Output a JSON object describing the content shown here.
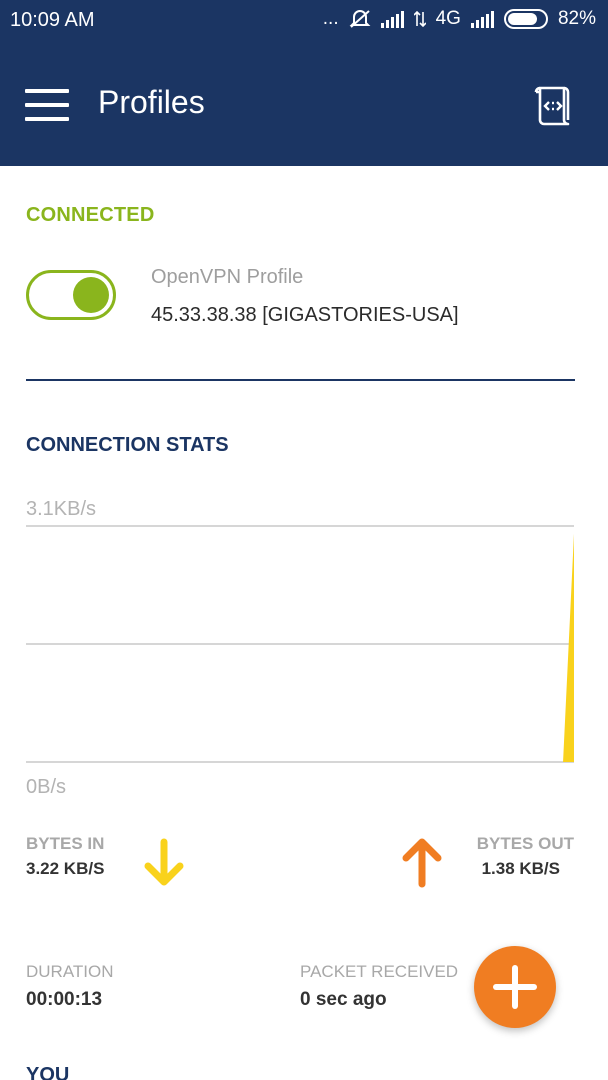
{
  "status_bar": {
    "time": "10:09  AM",
    "dots": "...",
    "network": "4G",
    "battery_percent": "82%",
    "battery_level": 0.82
  },
  "app_bar": {
    "title": "Profiles",
    "menu_icon": "hamburger-menu-icon",
    "import_icon": "import-profile-icon"
  },
  "connection": {
    "status": "CONNECTED",
    "toggle_on": true,
    "profile_name": "OpenVPN Profile",
    "server": "45.33.38.38 [GIGASTORIES-USA]"
  },
  "stats": {
    "title": "CONNECTION STATS",
    "bytes_in_label": "BYTES IN",
    "bytes_in_value": "3.22 KB/S",
    "bytes_out_label": "BYTES OUT",
    "bytes_out_value": "1.38 KB/S",
    "duration_label": "DURATION",
    "duration_value": "00:00:13",
    "packet_label": "PACKET RECEIVED",
    "packet_value": "0 sec ago"
  },
  "chart_data": {
    "type": "area",
    "y_max_label": "3.1KB/s",
    "y_min_label": "0B/s",
    "ylim": [
      0,
      3.1
    ],
    "grid": true,
    "series": [
      {
        "color": "#f9d21c",
        "values": [
          0,
          0,
          0,
          0,
          0,
          0,
          0,
          0,
          0,
          0,
          0,
          0,
          0,
          0,
          0,
          0,
          0,
          0,
          0,
          0,
          0,
          0,
          0,
          0,
          0,
          0,
          0,
          0,
          0,
          0,
          0,
          0,
          0,
          0,
          0,
          0,
          0,
          0,
          0,
          0,
          0,
          0,
          0,
          0,
          0,
          0,
          0,
          0,
          0,
          0,
          3.0
        ]
      }
    ]
  },
  "colors": {
    "primary": "#1b3563",
    "connected": "#8ab51d",
    "bytes_in_arrow": "#f9d21c",
    "bytes_out_arrow": "#f07d22",
    "fab": "#f07d22"
  },
  "section_you": "YOU",
  "fab_icon": "add-plus-icon"
}
